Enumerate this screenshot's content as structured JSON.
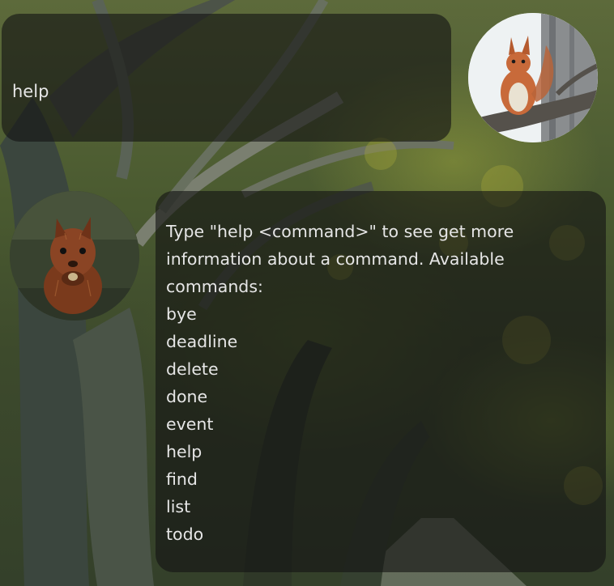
{
  "user_message": {
    "text": "help"
  },
  "bot_message": {
    "lines": [
      "Type \"help <command>\" to see get more",
      "information about a command. Available",
      "commands:",
      "bye",
      "deadline",
      "delete",
      "done",
      "event",
      "help",
      "find",
      "list",
      "todo"
    ]
  },
  "avatars": {
    "user": "squirrel-on-branch-avatar",
    "bot": "squirrel-eating-avatar"
  }
}
